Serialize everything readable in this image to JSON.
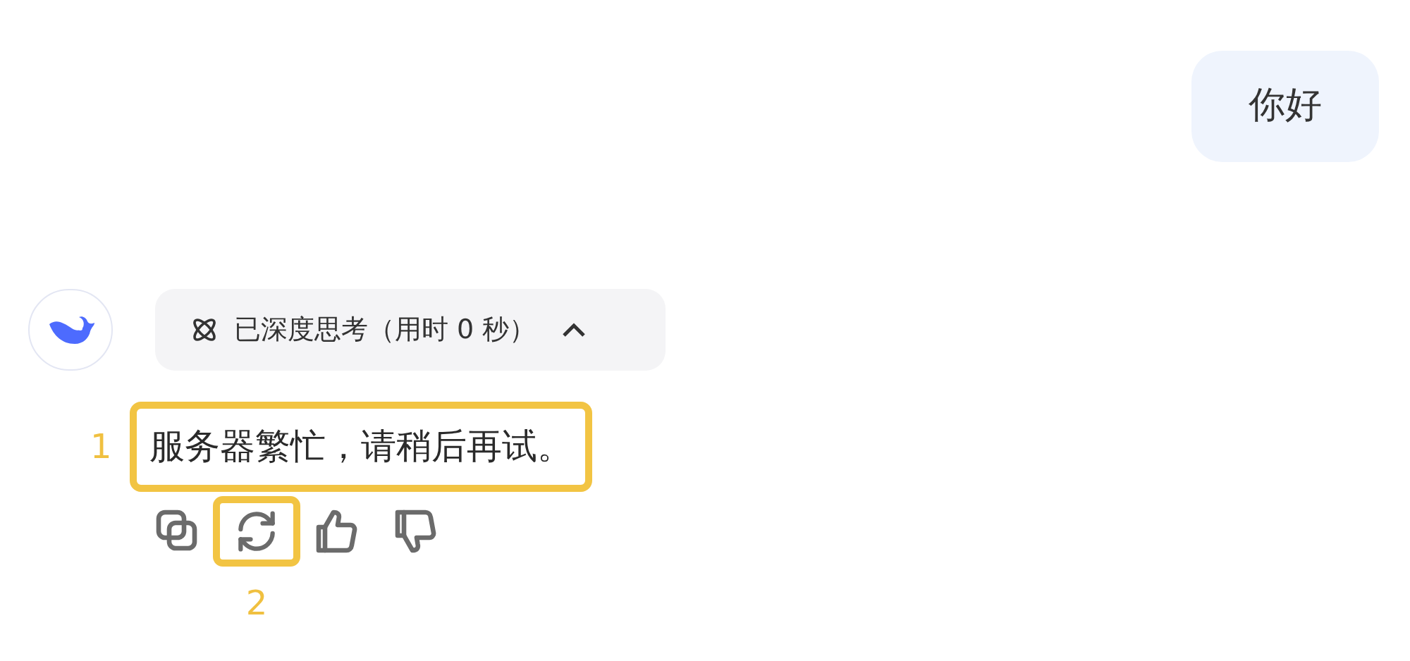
{
  "user_message": {
    "text": "你好"
  },
  "assistant": {
    "thinking": {
      "label": "已深度思考（用时 0 秒）",
      "expanded": true
    },
    "reply": {
      "text": "服务器繁忙，请稍后再试。",
      "callout": "1"
    },
    "actions": [
      {
        "kind": "copy"
      },
      {
        "kind": "regenerate",
        "callout": "2"
      },
      {
        "kind": "like"
      },
      {
        "kind": "dislike"
      }
    ]
  }
}
